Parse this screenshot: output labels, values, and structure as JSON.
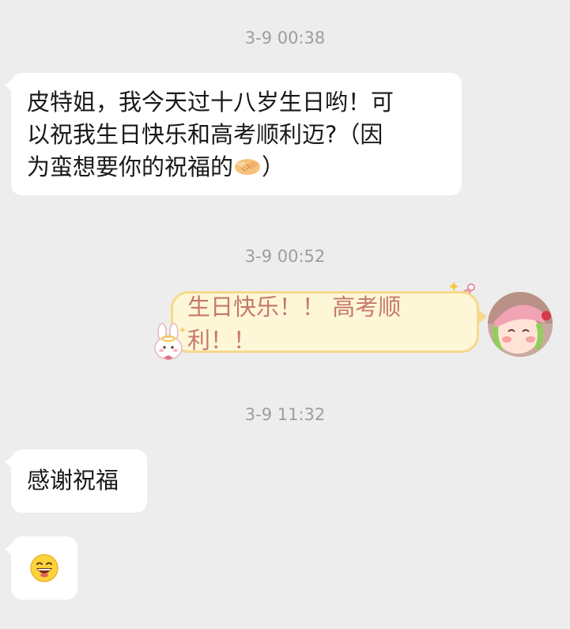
{
  "messages": [
    {
      "timestamp": "3-9 00:38"
    },
    {
      "incoming_1": {
        "lines": [
          "皮特姐，我今天过十八岁生日哟！可",
          "以祝我生日快乐和高考顺利迈?（因",
          "为蛮想要你的祝福的"
        ],
        "closing_paren": "）",
        "emoji": "handshake-icon"
      }
    }
  ],
  "timestamps": {
    "t1": "3-9 00:38",
    "t2": "3-9 00:52",
    "t3": "3-9 11:32"
  },
  "incoming_1": {
    "line1": "皮特姐，我今天过十八岁生日哟！可",
    "line2": "以祝我生日快乐和高考顺利迈?（因",
    "line3": "为蛮想要你的祝福的",
    "line3_end": "）"
  },
  "outgoing_1": {
    "text": "生日快乐！！ 高考顺利！！"
  },
  "incoming_2": {
    "text": "感谢祝福"
  },
  "incoming_3": {
    "emoji": "laughing-face-icon"
  },
  "colors": {
    "background": "#ededed",
    "incoming_bubble": "#ffffff",
    "outgoing_bubble_fill": "#fdf7d8",
    "outgoing_bubble_border": "#f6d98a",
    "outgoing_text": "#c8786e",
    "timestamp_text": "#9e9e9e"
  }
}
